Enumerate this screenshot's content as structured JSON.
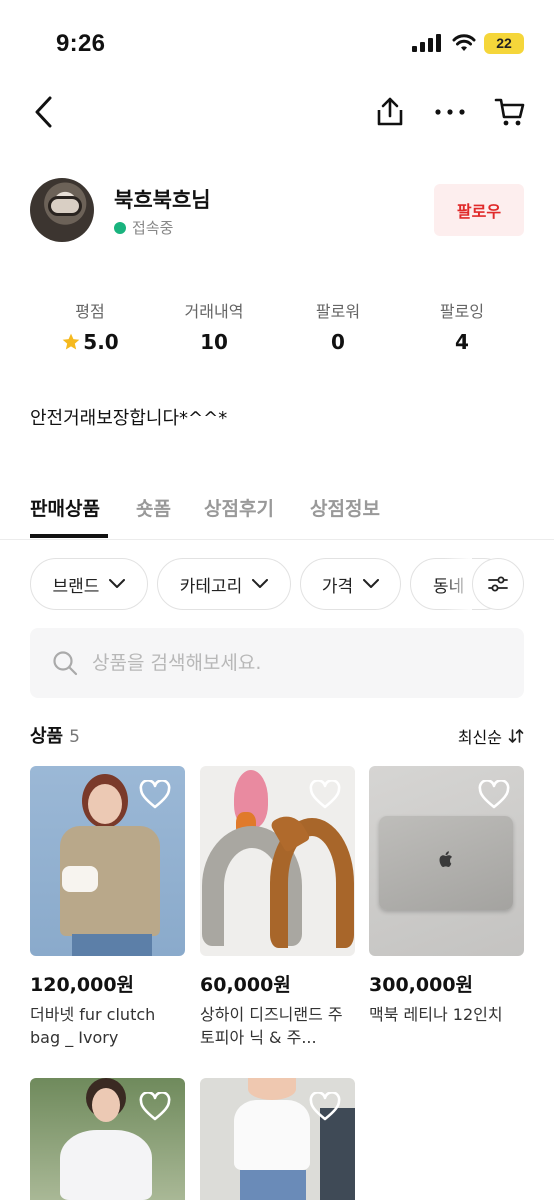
{
  "status_bar": {
    "time": "9:26",
    "battery": "22"
  },
  "nav": {
    "back": "back-icon",
    "share": "share-icon",
    "more": "more-icon",
    "cart": "cart-icon"
  },
  "profile": {
    "name": "북흐북흐님",
    "status": "접속중",
    "follow_label": "팔로우",
    "status_color": "#19b37e"
  },
  "stats": [
    {
      "label": "평점",
      "value": "5.0"
    },
    {
      "label": "거래내역",
      "value": "10"
    },
    {
      "label": "팔로워",
      "value": "0"
    },
    {
      "label": "팔로잉",
      "value": "4"
    }
  ],
  "bio": "안전거래보장합니다*^^*",
  "tabs": [
    {
      "label": "판매상품",
      "active": true
    },
    {
      "label": "숏폼",
      "active": false
    },
    {
      "label": "상점후기",
      "active": false
    },
    {
      "label": "상점정보",
      "active": false
    }
  ],
  "filters": [
    "브랜드",
    "카테고리",
    "가격",
    "동네"
  ],
  "search": {
    "placeholder": "상품을 검색해보세요."
  },
  "products_header": {
    "title": "상품",
    "count": "5",
    "sort": "최신순"
  },
  "products": [
    {
      "price": "120,000원",
      "name": "더바넷 fur clutch bag _ Ivory"
    },
    {
      "price": "60,000원",
      "name": "상하이 디즈니랜드 주토피아 닉 & 주..."
    },
    {
      "price": "300,000원",
      "name": "맥북 레티나 12인치"
    },
    {
      "price": "",
      "name": ""
    },
    {
      "price": "",
      "name": ""
    }
  ],
  "colors": {
    "follow_bg": "#fdeeee",
    "follow_text": "#e02a2a",
    "star": "#f5b91e"
  }
}
